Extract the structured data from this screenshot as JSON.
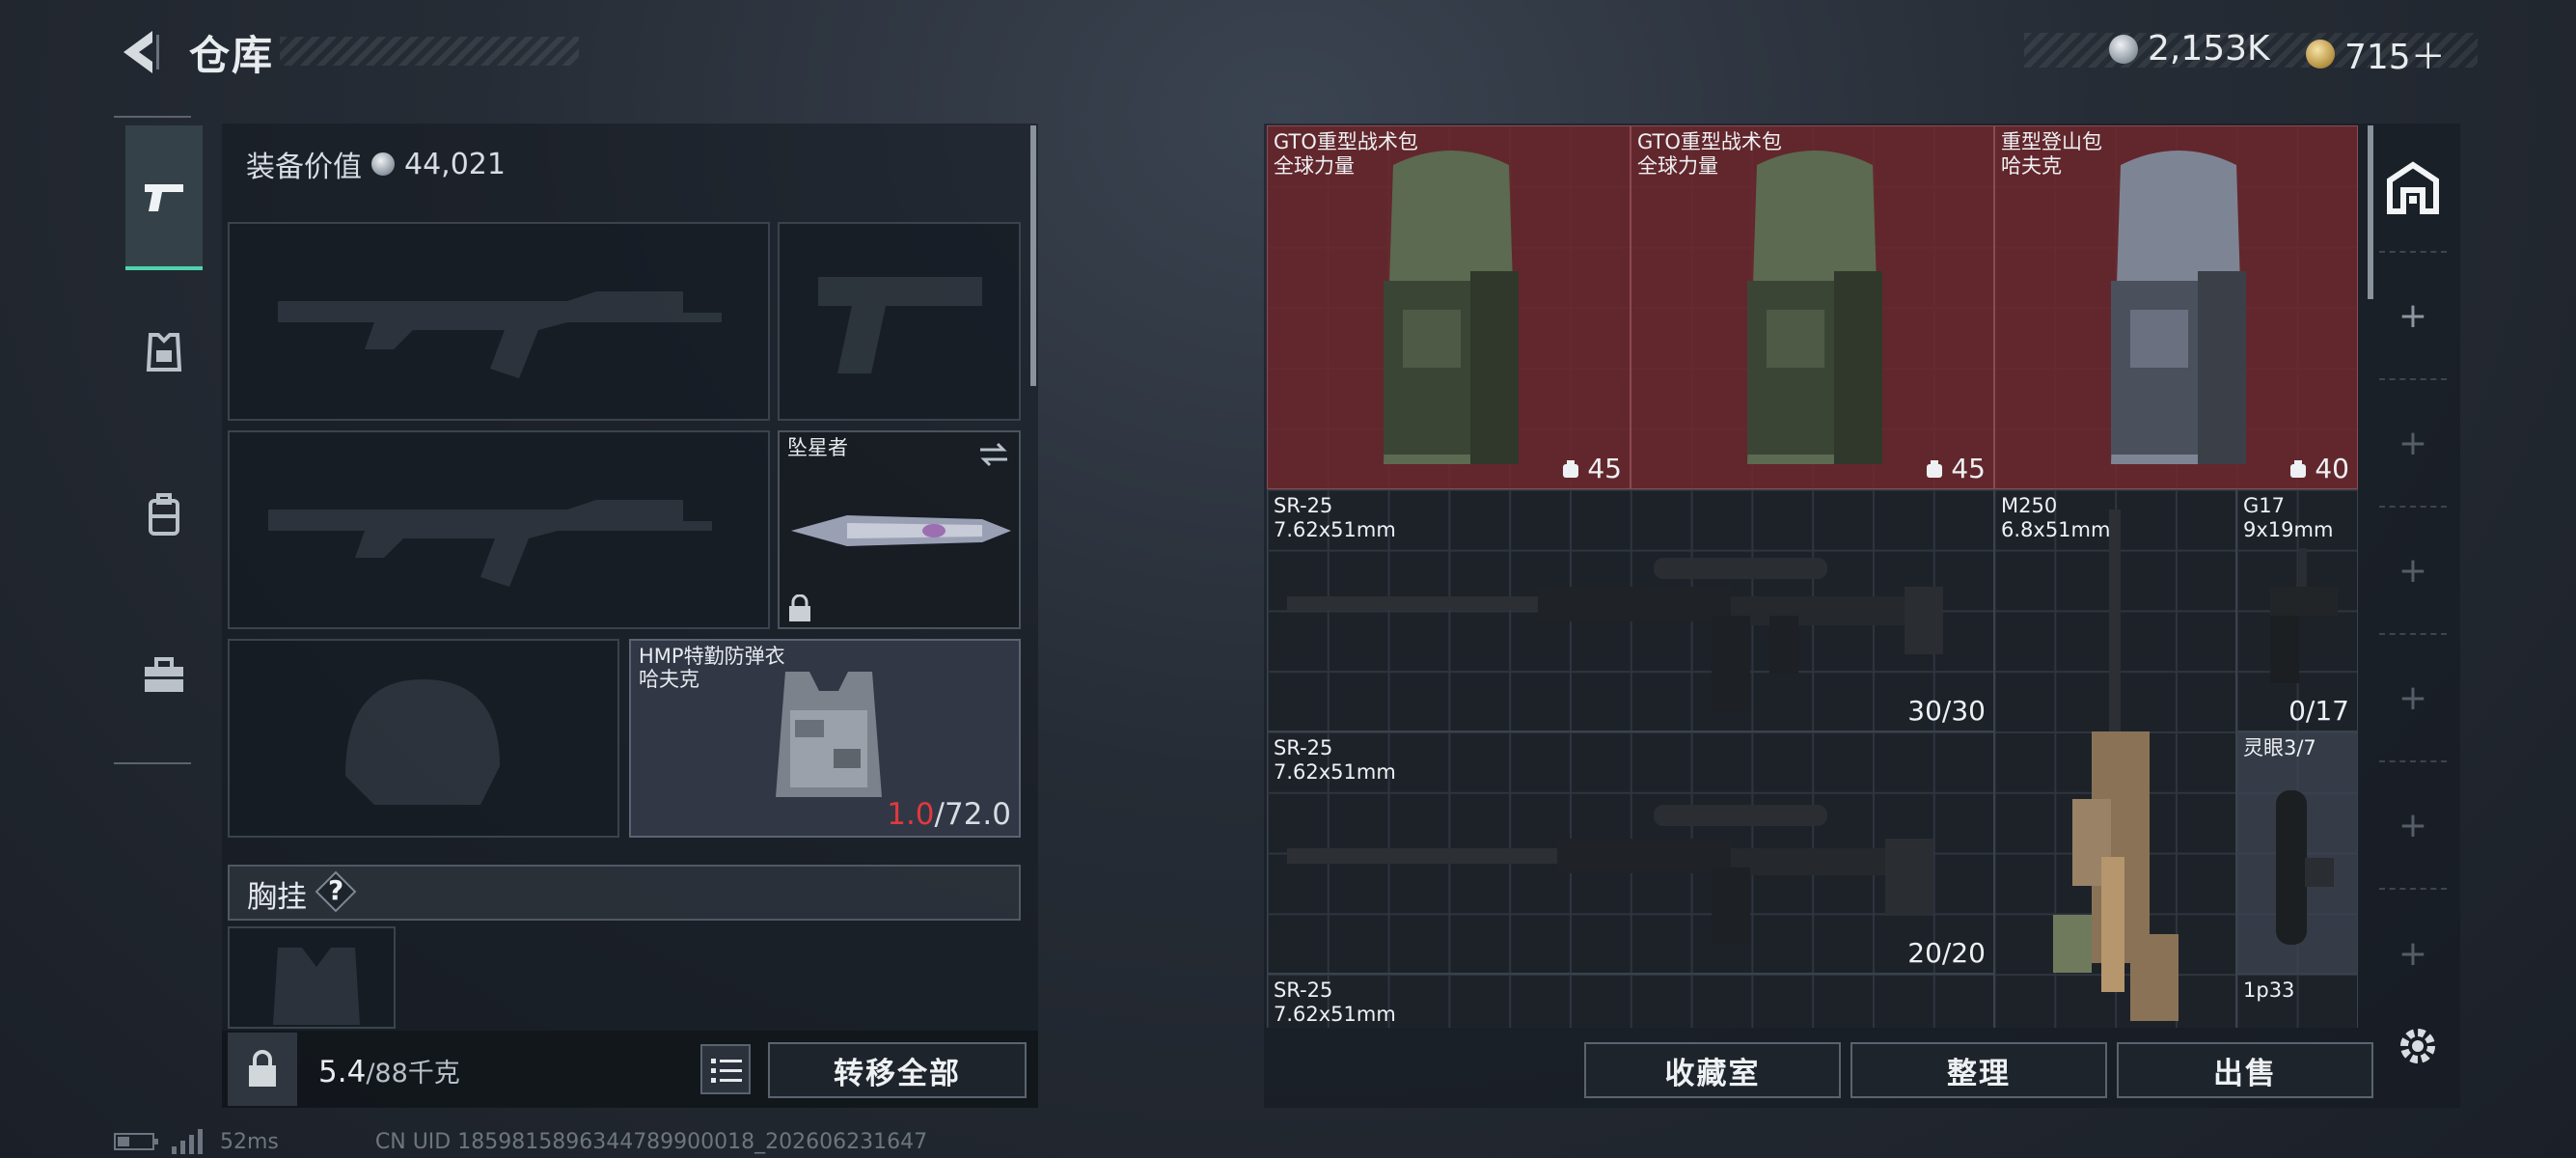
{
  "header": {
    "title": "仓库",
    "silver": "2,153K",
    "gold": "715＋"
  },
  "left": {
    "equip_value_label": "装备价值",
    "equip_value": "44,021",
    "melee_name": "坠星者",
    "vest_name": "HMP特勤防弹衣\n哈夫克",
    "vest_durability_current": "1.0",
    "vest_durability_max": "/72.0",
    "chest_rig_label": "胸挂",
    "help": "?",
    "weight_current": "5.4",
    "weight_max": "/88千克",
    "transfer_all": "转移全部"
  },
  "stash": {
    "items": [
      {
        "name": "GTO重型战术包\n全球力量",
        "count": "45"
      },
      {
        "name": "GTO重型战术包\n全球力量",
        "count": "45"
      },
      {
        "name": "重型登山包\n哈夫克",
        "count": "40"
      },
      {
        "name": "SR-25\n7.62x51mm",
        "count": "30/30"
      },
      {
        "name": "M250\n6.8x51mm",
        "count": ""
      },
      {
        "name": "G17\n9x19mm",
        "count": "0/17"
      },
      {
        "name": "SR-25\n7.62x51mm",
        "count": "20/20"
      },
      {
        "name": "灵眼3/7",
        "count": ""
      },
      {
        "name": "SR-25\n7.62x51mm",
        "count": ""
      },
      {
        "name": "1p33",
        "count": ""
      }
    ],
    "buttons": {
      "collection": "收藏室",
      "sort": "整理",
      "sell": "出售"
    },
    "side_plus": "+"
  },
  "status": {
    "latency": "52ms",
    "uid": "CN UID 1859815896344789900018_202606231647"
  },
  "colors": {
    "accent": "#4fd4b0",
    "danger": "#e0393e",
    "rare_bg": "#6e282d"
  }
}
